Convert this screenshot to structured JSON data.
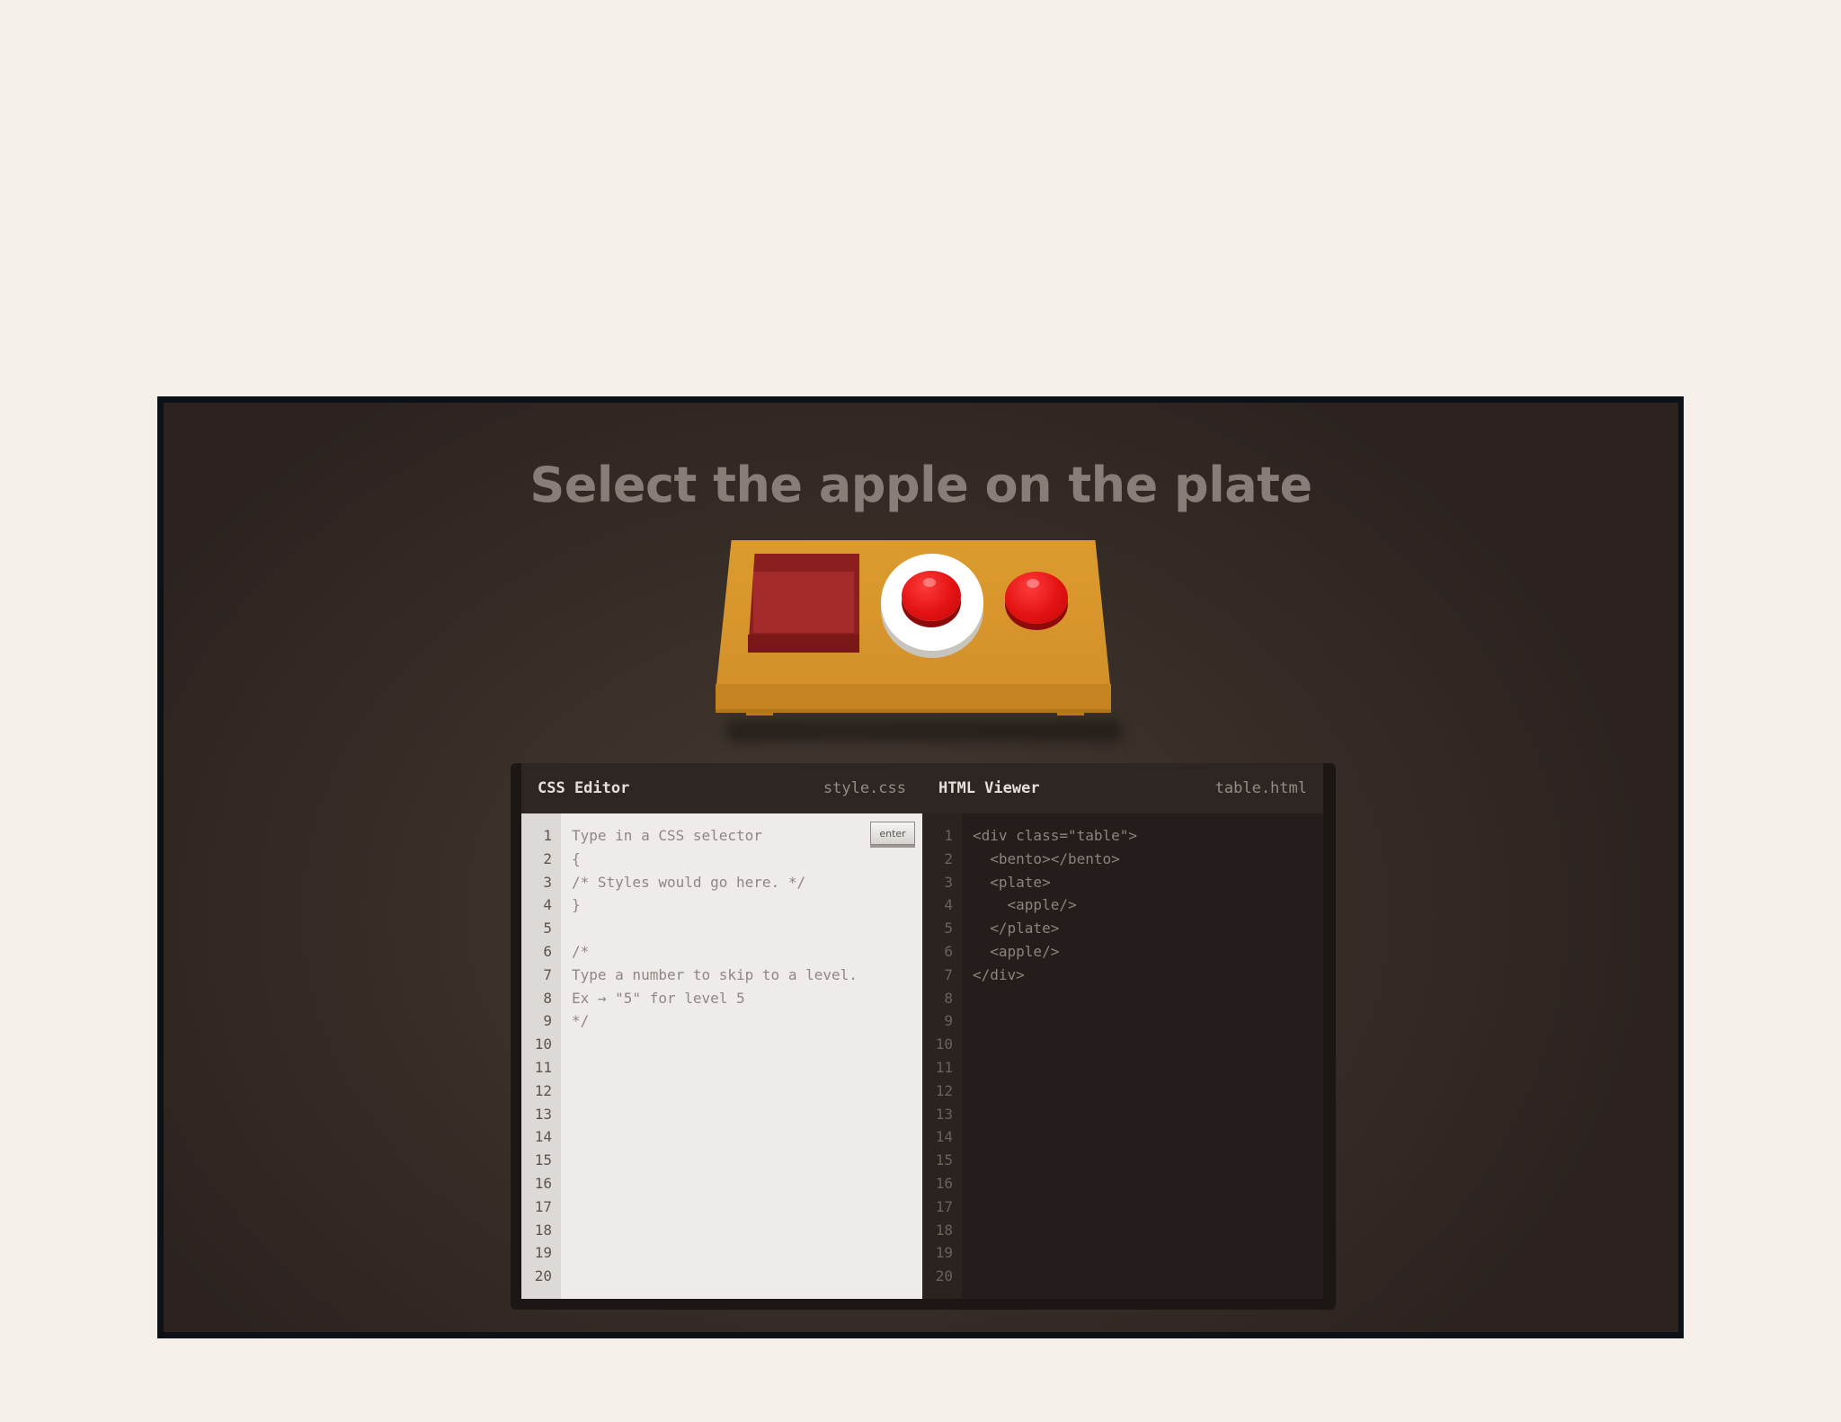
{
  "level": {
    "instruction": "Select the apple on the plate"
  },
  "table_scene": {
    "items": [
      {
        "type": "bento",
        "icon": "bento-box-icon"
      },
      {
        "type": "plate",
        "icon": "plate-icon"
      },
      {
        "type": "apple",
        "icon": "apple-icon",
        "on": "plate"
      },
      {
        "type": "apple",
        "icon": "apple-icon"
      }
    ]
  },
  "css_editor": {
    "title": "CSS Editor",
    "filename": "style.css",
    "enter_label": "enter",
    "lines": [
      "Type in a CSS selector",
      "{",
      "/* Styles would go here. */",
      "}",
      "",
      "/*",
      "Type a number to skip to a level.",
      "Ex → \"5\" for level 5",
      "*/",
      "",
      "",
      "",
      "",
      "",
      "",
      "",
      "",
      "",
      "",
      ""
    ]
  },
  "html_viewer": {
    "title": "HTML Viewer",
    "filename": "table.html",
    "lines": [
      "<div class=\"table\">",
      "  <bento></bento>",
      "  <plate>",
      "    <apple/>",
      "  </plate>",
      "  <apple/>",
      "</div>",
      "",
      "",
      "",
      "",
      "",
      "",
      "",
      "",
      "",
      "",
      "",
      "",
      ""
    ]
  },
  "line_numbers": [
    "1",
    "2",
    "3",
    "4",
    "5",
    "6",
    "7",
    "8",
    "9",
    "10",
    "11",
    "12",
    "13",
    "14",
    "15",
    "16",
    "17",
    "18",
    "19",
    "20"
  ],
  "colors": {
    "page_bg": "#f5efea",
    "stage_bg": "#3a3029",
    "table_wood": "#dc9b2e",
    "apple_red": "#e31212",
    "bento_red": "#8b1f1f"
  }
}
